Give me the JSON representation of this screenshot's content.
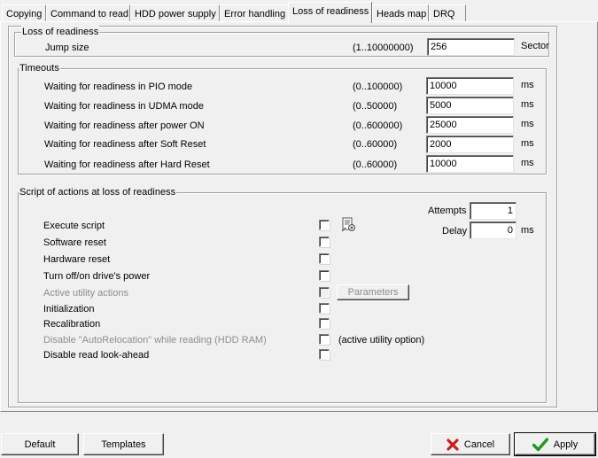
{
  "tabs": [
    {
      "label": "Copying"
    },
    {
      "label": "Command to read"
    },
    {
      "label": "HDD power supply"
    },
    {
      "label": "Error handling"
    },
    {
      "label": "Loss of readiness"
    },
    {
      "label": "Heads map"
    },
    {
      "label": "DRQ"
    }
  ],
  "active_tab": "Loss of readiness",
  "loss_group": {
    "title": "Loss of readiness",
    "jump_label": "Jump size",
    "jump_range": "(1..10000000)",
    "jump_value": "256",
    "jump_unit": "Sector"
  },
  "timeouts": {
    "title": "Timeouts",
    "rows": [
      {
        "label": "Waiting for readiness in PIO mode",
        "range": "(0..100000)",
        "value": "10000",
        "unit": "ms"
      },
      {
        "label": "Waiting for readiness in UDMA mode",
        "range": "(0..50000)",
        "value": "5000",
        "unit": "ms"
      },
      {
        "label": "Waiting for readiness after power ON",
        "range": "(0..600000)",
        "value": "25000",
        "unit": "ms"
      },
      {
        "label": "Waiting for readiness after Soft Reset",
        "range": "(0..60000)",
        "value": "2000",
        "unit": "ms"
      },
      {
        "label": "Waiting for readiness after Hard Reset",
        "range": "(0..60000)",
        "value": "10000",
        "unit": "ms"
      }
    ]
  },
  "script": {
    "title": "Script of actions at loss of readiness",
    "attempts_label": "Attempts",
    "attempts_value": "1",
    "delay_label": "Delay",
    "delay_value": "0",
    "delay_unit": "ms",
    "items": [
      {
        "label": "Execute script",
        "enabled": true,
        "checked": false
      },
      {
        "label": "Software reset",
        "enabled": true,
        "checked": false
      },
      {
        "label": "Hardware reset",
        "enabled": true,
        "checked": false
      },
      {
        "label": "Turn off/on drive's power",
        "enabled": true,
        "checked": false
      },
      {
        "label": "Active utility actions",
        "enabled": false,
        "checked": false
      },
      {
        "label": "Initialization",
        "enabled": true,
        "checked": false
      },
      {
        "label": "Recalibration",
        "enabled": true,
        "checked": false
      },
      {
        "label": "Disable \"AutoRelocation\" while reading (HDD RAM)",
        "enabled": false,
        "checked": false
      },
      {
        "label": "Disable read look-ahead",
        "enabled": true,
        "checked": false
      }
    ],
    "parameters_label": "Parameters",
    "active_utility_note": "(active utility option)",
    "script_icon": "script-edit-icon"
  },
  "footer": {
    "default_label": "Default",
    "templates_label": "Templates",
    "cancel_label": "Cancel",
    "apply_label": "Apply",
    "cancel_icon": "red-x-icon",
    "apply_icon": "green-check-icon"
  },
  "colors": {
    "cancel_icon": "#c8201c",
    "apply_icon": "#1e9a1e",
    "disabled_text": "#8d8d8d"
  }
}
